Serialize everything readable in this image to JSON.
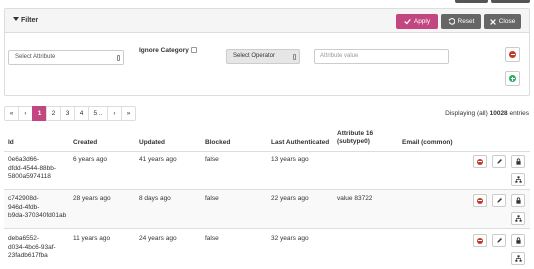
{
  "filter": {
    "title": "Filter",
    "apply_label": "Apply",
    "reset_label": "Reset",
    "close_label": "Close",
    "attribute_select": "Select Attribute",
    "ignore_category_label": "Ignore Category",
    "operator_select": "Select Operator",
    "value_placeholder": "Attribute value"
  },
  "pagination": {
    "prev_first": "«",
    "prev": "‹",
    "pages": [
      "1",
      "2",
      "3",
      "4",
      "5 .."
    ],
    "next": "›",
    "next_last": "»",
    "active_page": "1"
  },
  "summary": {
    "prefix": "Displaying (all)",
    "count": "10028",
    "suffix": "entries"
  },
  "table": {
    "headers": {
      "id": "Id",
      "created": "Created",
      "updated": "Updated",
      "blocked": "Blocked",
      "last_authenticated": "Last Authenticated",
      "attribute16_line1": "Attribute 16",
      "attribute16_line2": "(subtype0)",
      "email": "Email (common)"
    },
    "rows": [
      {
        "id_lines": [
          "0e6a3d66-",
          "dfdd-4544-88bb-",
          "5800a5974118"
        ],
        "created": "6 years ago",
        "updated": "41 years ago",
        "blocked": "false",
        "last_authenticated": "13 years ago",
        "attribute16": "",
        "email": ""
      },
      {
        "id_lines": [
          "c742908d-",
          "946d-4fdb-",
          "b9da-370340fd01ab"
        ],
        "created": "28 years ago",
        "updated": "8 days ago",
        "blocked": "false",
        "last_authenticated": "22 years ago",
        "attribute16": "value 83722",
        "email": ""
      },
      {
        "id_lines": [
          "deba6552-",
          "d034-4bc6-93af-",
          "23fadb617fba"
        ],
        "created": "11 years ago",
        "updated": "24 years ago",
        "blocked": "false",
        "last_authenticated": "32 years ago",
        "attribute16": "",
        "email": ""
      }
    ]
  },
  "colors": {
    "accent": "#c2467f",
    "neutral_button": "#666666",
    "danger": "#c0392b",
    "success": "#27ae60"
  }
}
